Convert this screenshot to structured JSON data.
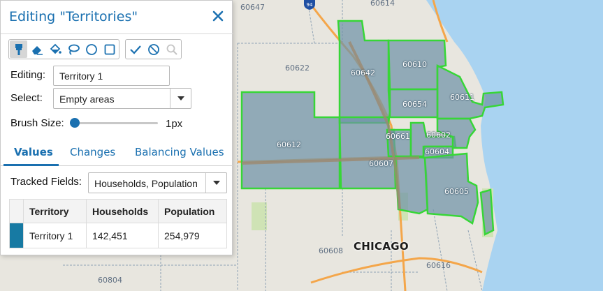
{
  "panel": {
    "title": "Editing \"Territories\"",
    "editing_label": "Editing:",
    "editing_value": "Territory 1",
    "select_label": "Select:",
    "select_value": "Empty areas",
    "brush_label": "Brush Size:",
    "brush_value": "1px",
    "brush_level": 0.0,
    "tabs": [
      "Values",
      "Changes",
      "Balancing Values"
    ],
    "active_tab": "Values",
    "tracked_label": "Tracked Fields:",
    "tracked_value": "Households, Population",
    "table": {
      "headers": [
        "Territory",
        "Households",
        "Population"
      ],
      "rows": [
        {
          "territory": "Territory 1",
          "households": "142,451",
          "population": "254,979",
          "color": "#177aa3"
        }
      ]
    }
  },
  "toolbar": {
    "tools": [
      "brush-icon",
      "eraser-icon",
      "fill-icon",
      "lasso-icon",
      "circle-select-icon",
      "rectangle-select-icon"
    ],
    "actions": [
      "check-icon",
      "cancel-icon",
      "search-icon"
    ]
  },
  "map": {
    "zip_labels": [
      "60647",
      "60614",
      "60622",
      "60642",
      "60610",
      "60611",
      "60654",
      "60612",
      "60661",
      "60602",
      "60604",
      "60607",
      "60605",
      "60608",
      "60616",
      "60804"
    ],
    "city": "CHICAGO",
    "highway": "94",
    "colors": {
      "territory_fill": "#6f93a8",
      "territory_border": "#37d637",
      "water": "#a9d3f1",
      "land": "#e8e6df"
    }
  }
}
